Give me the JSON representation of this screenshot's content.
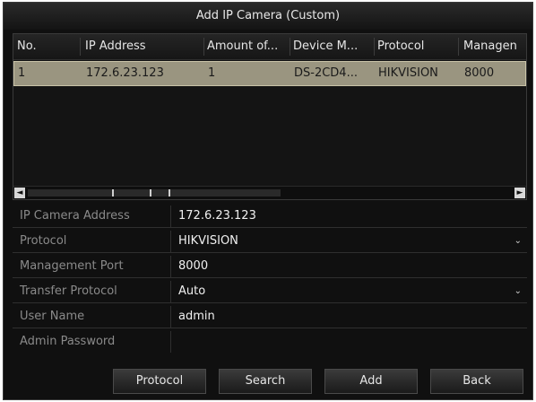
{
  "dialog": {
    "title": "Add IP Camera (Custom)"
  },
  "table": {
    "columns": [
      "No.",
      "IP Address",
      "Amount of...",
      "Device M...",
      "Protocol",
      "Managen"
    ],
    "rows": [
      [
        "1",
        "172.6.23.123",
        "1",
        "DS-2CD4...",
        "HIKVISION",
        "8000"
      ]
    ]
  },
  "form": {
    "ip_camera_address": {
      "label": "IP Camera Address",
      "value": "172.6.23.123"
    },
    "protocol": {
      "label": "Protocol",
      "value": "HIKVISION"
    },
    "management_port": {
      "label": "Management Port",
      "value": "8000"
    },
    "transfer_protocol": {
      "label": "Transfer Protocol",
      "value": "Auto"
    },
    "user_name": {
      "label": "User Name",
      "value": "admin"
    },
    "admin_password": {
      "label": "Admin Password",
      "value": ""
    }
  },
  "buttons": {
    "protocol": "Protocol",
    "search": "Search",
    "add": "Add",
    "back": "Back"
  },
  "icons": {
    "scroll_left": "◄",
    "scroll_right": "►",
    "dropdown": "⌄"
  },
  "colors": {
    "selected_row": "#9a9580",
    "background": "#101010"
  }
}
